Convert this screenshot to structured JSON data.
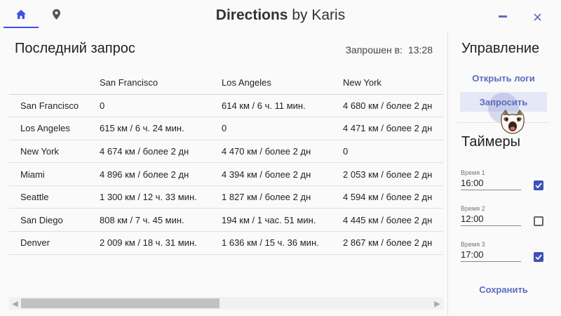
{
  "titlebar": {
    "title_bold": "Directions",
    "title_rest": "by Karis",
    "nav": [
      {
        "name": "home",
        "icon": "home-icon",
        "active": true
      },
      {
        "name": "map",
        "icon": "map-pin-icon",
        "active": false
      }
    ],
    "minimize_icon": "minimize-icon",
    "close_icon": "close-icon"
  },
  "main": {
    "title": "Последний запрос",
    "requested_label": "Запрошен в:",
    "requested_time": "13:28",
    "columns": [
      "",
      "San Francisco",
      "Los Angeles",
      "New York"
    ],
    "rows": [
      {
        "city": "San Francisco",
        "cells": [
          "0",
          "614 км / 6 ч. 11 мин.",
          "4 680 км / более 2 дн"
        ]
      },
      {
        "city": "Los Angeles",
        "cells": [
          "615 км / 6 ч. 24 мин.",
          "0",
          "4 471 км / более 2 дн"
        ]
      },
      {
        "city": "New York",
        "cells": [
          "4 674 км / более 2 дн",
          "4 470 км / более 2 дн",
          "0"
        ]
      },
      {
        "city": "Miami",
        "cells": [
          "4 896 км / более 2 дн",
          "4 394 км / более 2 дн",
          "2 053 км / более 2 дн"
        ]
      },
      {
        "city": "Seattle",
        "cells": [
          "1 300 км / 12 ч. 33 мин.",
          "1 827 км / более 2 дн",
          "4 594 км / более 2 дн"
        ]
      },
      {
        "city": "San Diego",
        "cells": [
          "808 км / 7 ч. 45 мин.",
          "194 км / 1 час. 51 мин.",
          "4 445 км / более 2 дн"
        ]
      },
      {
        "city": "Denver",
        "cells": [
          "2 009 км / 18 ч. 31 мин.",
          "1 636 км / 15 ч. 36 мин.",
          "2 867 км / более 2 дн"
        ]
      }
    ]
  },
  "side": {
    "control_title": "Управление",
    "open_logs": "Открыть логи",
    "request": "Запросить",
    "timers_title": "Таймеры",
    "timers": [
      {
        "label": "Время 1",
        "value": "16:00",
        "checked": true
      },
      {
        "label": "Время 2",
        "value": "12:00",
        "checked": false
      },
      {
        "label": "Время 3",
        "value": "17:00",
        "checked": true
      }
    ],
    "save": "Сохранить"
  },
  "colors": {
    "accent": "#3f51b5",
    "tab_indicator": "#3f51e8",
    "button_text": "#5c6bc0"
  }
}
